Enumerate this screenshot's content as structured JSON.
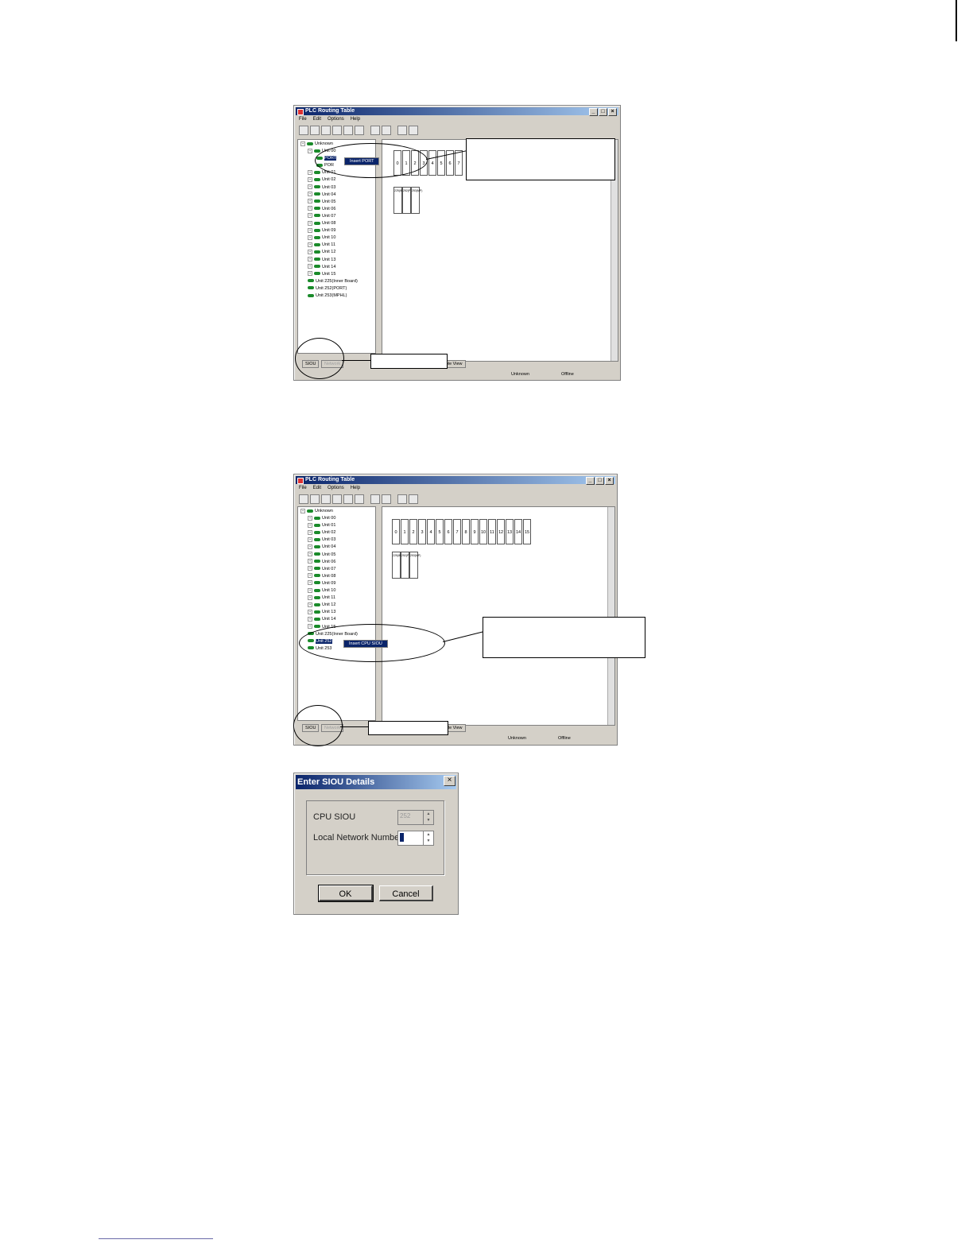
{
  "win1": {
    "title": "PLC Routing Table",
    "menu": [
      "File",
      "Edit",
      "Options",
      "Help"
    ],
    "tree": {
      "root": "Unknown",
      "unit00": "Unit 00",
      "child1": "PORT",
      "child2": "POR",
      "units": [
        "Unit 01",
        "Unit 02",
        "Unit 03",
        "Unit 04",
        "Unit 05",
        "Unit 06",
        "Unit 07",
        "Unit 08",
        "Unit 09",
        "Unit 10",
        "Unit 11",
        "Unit 12",
        "Unit 13",
        "Unit 14",
        "Unit 15",
        "Unit 225(Inner Board)",
        "Unit 252(PORT)",
        "Unit 253(MPHL)"
      ]
    },
    "context_menu": "Insert PORT",
    "slots": [
      "0",
      "1",
      "2",
      "3",
      "4",
      "5",
      "6",
      "7"
    ],
    "small_slots": [
      "225(IB)",
      "252(PT)",
      "253(MP)"
    ],
    "tabs": {
      "siou": "SIOU",
      "disabled": "Network",
      "table_view": "Table View"
    },
    "status": {
      "left": "Unknown",
      "right": "Offline"
    }
  },
  "win2": {
    "title": "PLC Routing Table",
    "menu": [
      "File",
      "Edit",
      "Options",
      "Help"
    ],
    "tree": {
      "root": "Unknown",
      "units": [
        "Unit 00",
        "Unit 01",
        "Unit 02",
        "Unit 03",
        "Unit 04",
        "Unit 05",
        "Unit 06",
        "Unit 07",
        "Unit 08",
        "Unit 09",
        "Unit 10",
        "Unit 11",
        "Unit 12",
        "Unit 13",
        "Unit 14",
        "Unit 15",
        "Unit 225(Inner Board)"
      ],
      "selected": "Unit 252",
      "last": "Unit 253"
    },
    "context_menu": "Insert CPU SIOU",
    "slots": [
      "0",
      "1",
      "2",
      "3",
      "4",
      "5",
      "6",
      "7",
      "8",
      "9",
      "10",
      "11",
      "12",
      "13",
      "14",
      "15"
    ],
    "small_slots": [
      "225(IB)",
      "252(PT)",
      "253(MP)"
    ],
    "tabs": {
      "siou": "SIOU",
      "disabled": "Network",
      "table_view": "Table View"
    },
    "status": {
      "left": "Unknown",
      "right": "Offline"
    }
  },
  "dialog": {
    "title": "Enter SIOU Details",
    "close": "×",
    "cpu_siou_label": "CPU SIOU",
    "cpu_siou_value": "252",
    "local_network_label": "Local Network Number",
    "ok": "OK",
    "cancel": "Cancel"
  }
}
